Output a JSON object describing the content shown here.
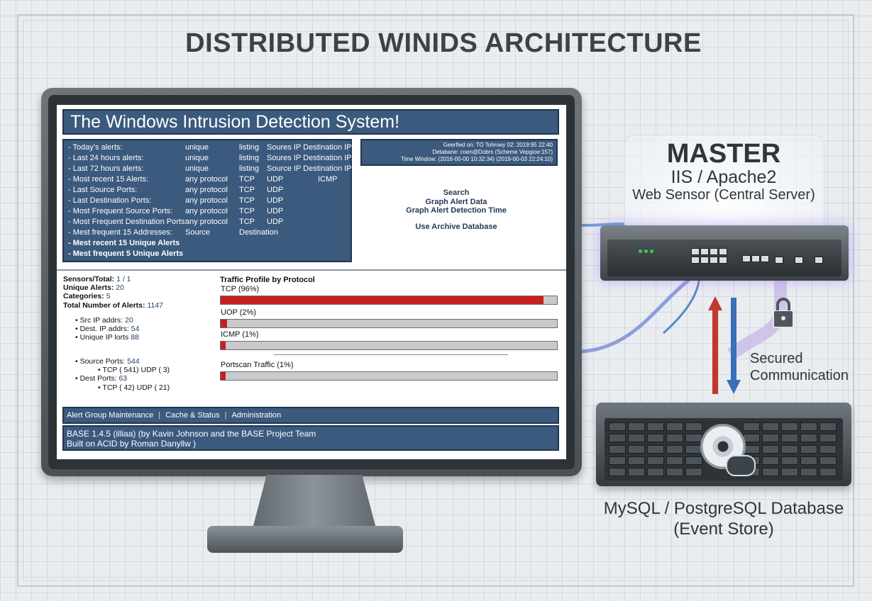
{
  "diagram": {
    "title": "DISTRIBUTED WINIDS ARCHITECTURE"
  },
  "screen": {
    "title": "The Windows Intrusion Detection System!",
    "menu": [
      {
        "label": "- Today's alerts:",
        "c1": "unique",
        "c2": "listing",
        "c3": "Soures IP Destination IP",
        "c4": ""
      },
      {
        "label": "- Last 24 hours alerts:",
        "c1": "unique",
        "c2": "listing",
        "c3": "Soures IP Destination IP",
        "c4": ""
      },
      {
        "label": "- Last 72 hours alerts:",
        "c1": "unique",
        "c2": "listing",
        "c3": "Source IP Destination IP",
        "c4": ""
      },
      {
        "label": "- Most recent 15 Alerts:",
        "c1": "any protocol",
        "c2": "TCP",
        "c3": "UDP",
        "c4": "ICMP"
      },
      {
        "label": "- Last Source Ports:",
        "c1": "any protocol",
        "c2": "TCP",
        "c3": "UDP",
        "c4": ""
      },
      {
        "label": "- Last Destination Ports:",
        "c1": "any protocol",
        "c2": "TCP",
        "c3": "UDP",
        "c4": ""
      },
      {
        "label": "- Most Frequent Source Ports:",
        "c1": "any protocol",
        "c2": "TCP",
        "c3": "UDP",
        "c4": ""
      },
      {
        "label": "- Most Frequent Destination Ports:",
        "c1": "any protocol",
        "c2": "TCP",
        "c3": "UDP",
        "c4": ""
      },
      {
        "label": "- Mest frequent 15 Addresses:",
        "c1": "Source",
        "c2": "Destination",
        "c3": "",
        "c4": ""
      },
      {
        "label": "- Mest recent 15 Unique Alerts",
        "c1": "",
        "c2": "",
        "c3": "",
        "c4": ""
      },
      {
        "label": "- Mest frequent 5 Unique Alerts",
        "c1": "",
        "c2": "",
        "c3": "",
        "c4": ""
      }
    ],
    "info": {
      "queried": "Geerfied on: TO Tohroey 02: 2019:95 22:40",
      "database": "Detabane: coen@Dobrs     (Scheme Vepgioe:157)",
      "window": "Time Window: (2016-00-00 10:32:34)  (2019-00-03 22:24:10)"
    },
    "links": [
      "Search",
      "Graph Alert Data",
      "Graph Alert Detection Time",
      "Use Archive Database"
    ],
    "stats": {
      "sensors_label": "Sensors/Total:",
      "sensors_value": "1 / 1",
      "unique_label": "Unique Alerts:",
      "unique_value": "20",
      "categories_label": "Categories:",
      "categories_value": "5",
      "total_label": "Total Number of Alerts:",
      "total_value": "1147",
      "src_ip_label": "Src IP addrs:",
      "src_ip_value": "20",
      "dest_ip_label": "Dest. IP addrs:",
      "dest_ip_value": "54",
      "unique_ip_label": "Unique IP lorts",
      "unique_ip_value": "88",
      "source_ports_label": "Source Ports:",
      "source_ports_value": "544",
      "source_ports_detail": "TCP ( 541)  UDP ( 3)",
      "dest_ports_label": "Dest Ports:",
      "dest_ports_value": "63",
      "dest_ports_detail": "TCP ( 42)  UDP ( 21)"
    },
    "traffic": {
      "title": "Traffic Profile by Protocol",
      "bars": [
        {
          "label": "TCP (96%)",
          "percent": 96
        },
        {
          "label": "UOP (2%)",
          "percent": 2
        },
        {
          "label": "ICMP (1%)",
          "percent": 1
        },
        {
          "label": "Portscan Traffic (1%)",
          "percent": 1
        }
      ]
    },
    "footer_links": [
      "Alert Group Maintenance",
      "Cache & Status",
      "Administration"
    ],
    "footer_line1": "BASE 1.4.5 (illiaa) (by Kavin Johnson and the BASE Project Team",
    "footer_line2": "Built on ACID by Roman Danyllw )"
  },
  "master": {
    "title": "MASTER",
    "subtitle1": "IIS / Apache2",
    "subtitle2": "Web Sensor (Central Server)"
  },
  "connection": {
    "line1": "Secured",
    "line2": "Communication"
  },
  "database": {
    "title": "MySQL / PostgreSQL Database",
    "subtitle": "(Event Store)"
  },
  "colors": {
    "panel": "#3b5a7e",
    "bar_fill": "#c81e1e",
    "arrow_up": "#c0392b",
    "arrow_down": "#3b6fb6"
  }
}
